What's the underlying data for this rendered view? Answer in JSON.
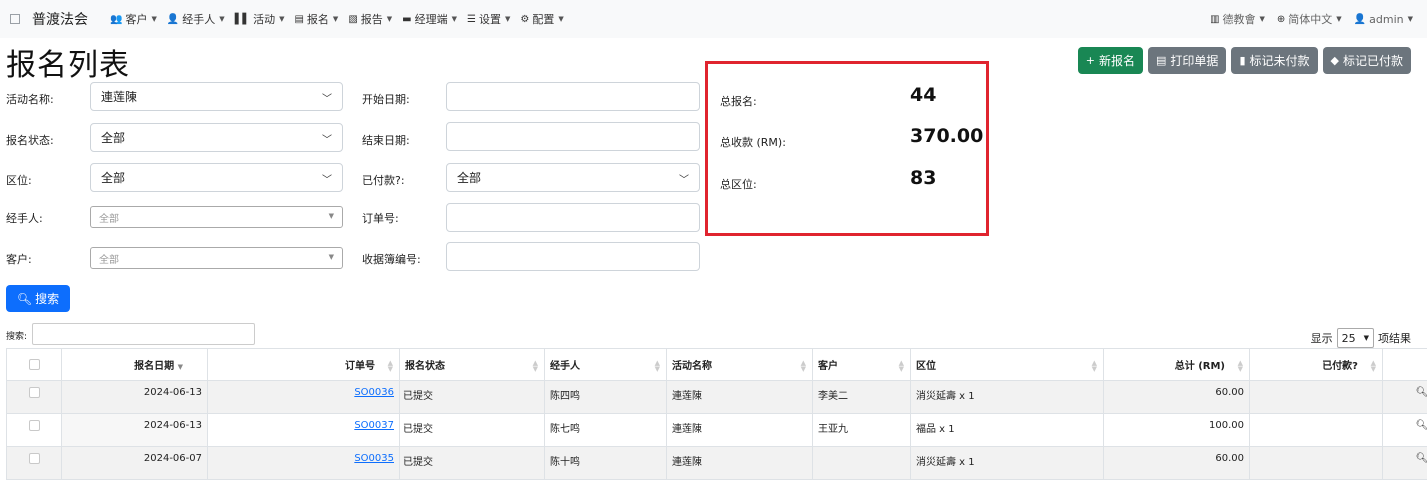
{
  "navbar": {
    "brand": "普渡法会",
    "menu": [
      {
        "label": "客户",
        "icon": "users-icon",
        "glyph": "👥"
      },
      {
        "label": "经手人",
        "icon": "user-icon",
        "glyph": "👤"
      },
      {
        "label": "活动",
        "icon": "columns-icon",
        "glyph": "▌▌"
      },
      {
        "label": "报名",
        "icon": "list-icon",
        "glyph": "▤"
      },
      {
        "label": "报告",
        "icon": "report-icon",
        "glyph": "▧"
      },
      {
        "label": "经理端",
        "icon": "briefcase-icon",
        "glyph": "▬"
      },
      {
        "label": "设置",
        "icon": "sliders-icon",
        "glyph": "☰"
      },
      {
        "label": "配置",
        "icon": "gear-icon",
        "glyph": "⚙"
      }
    ],
    "right": [
      {
        "label": "德教會",
        "icon": "building-icon",
        "glyph": "▥"
      },
      {
        "label": "简体中文",
        "icon": "globe-icon",
        "glyph": "⊕"
      },
      {
        "label": "admin",
        "icon": "user-icon",
        "glyph": "👤"
      }
    ]
  },
  "page_title": "报名列表",
  "actions": {
    "new": "新报名",
    "print": "打印单据",
    "mark_unpaid": "标记未付款",
    "mark_paid": "标记已付款"
  },
  "filters": {
    "event_label": "活动名称:",
    "event_value": "連莲陳",
    "status_label": "报名状态:",
    "status_value": "全部",
    "area_label": "区位:",
    "area_value": "全部",
    "handler_label": "经手人:",
    "handler_value": "全部",
    "customer_label": "客户:",
    "customer_value": "全部",
    "start_label": "开始日期:",
    "end_label": "结束日期:",
    "paid_label": "已付款?:",
    "paid_value": "全部",
    "order_label": "订单号:",
    "receipt_label": "收据簿编号:",
    "search_button": "搜索"
  },
  "summary": {
    "total_reg_label": "总报名:",
    "total_reg_value": "44",
    "total_income_label": "总收款 (RM):",
    "total_income_value": "370.00",
    "total_area_label": "总区位:",
    "total_area_value": "83"
  },
  "datatable": {
    "search_label": "搜索:",
    "length_prefix": "显示",
    "length_value": "25",
    "length_suffix": "项结果",
    "columns": [
      "报名日期",
      "订单号",
      "报名状态",
      "经手人",
      "活动名称",
      "客户",
      "区位",
      "总计 (RM)",
      "已付款?"
    ],
    "rows": [
      {
        "date": "2024-06-13",
        "order": "SO0036",
        "status": "已提交",
        "handler": "陈四鸣",
        "event": "連莲陳",
        "customer": "李美二",
        "area": "消災延壽 x 1",
        "total": "60.00",
        "paid": ""
      },
      {
        "date": "2024-06-13",
        "order": "SO0037",
        "status": "已提交",
        "handler": "陈七鸣",
        "event": "連莲陳",
        "customer": "王亚九",
        "area": "福品 x 1",
        "total": "100.00",
        "paid": ""
      },
      {
        "date": "2024-06-07",
        "order": "SO0035",
        "status": "已提交",
        "handler": "陈十鸣",
        "event": "連莲陳",
        "customer": "",
        "area": "消災延壽 x 1",
        "total": "60.00",
        "paid": ""
      }
    ]
  },
  "colors": {
    "primary": "#0d6efd",
    "success": "#198754",
    "secondary": "#6c757d",
    "highlight_border": "#e0242f"
  }
}
